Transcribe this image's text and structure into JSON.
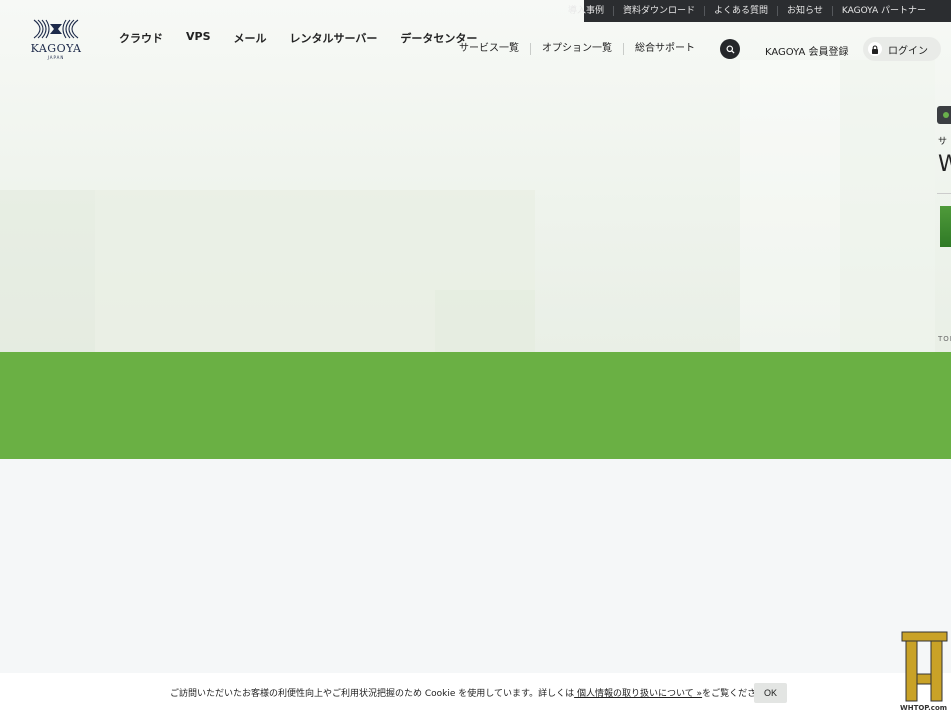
{
  "util_nav": {
    "items": [
      "導入事例",
      "資料ダウンロード",
      "よくある質問",
      "お知らせ",
      "KAGOYA パートナー"
    ]
  },
  "logo": {
    "word": "KAGOYA",
    "sub": "JAPAN"
  },
  "main_nav": {
    "items": [
      "クラウド",
      "VPS",
      "メール",
      "レンタルサーバー",
      "データセンター"
    ]
  },
  "sub_nav": {
    "items": [
      "サービス一覧",
      "オプション一覧",
      "総合サポート"
    ]
  },
  "header": {
    "member_label": "KAGOYA 会員登録",
    "login_label": "ログイン"
  },
  "side_panel": {
    "label": "サ",
    "title": "W",
    "crumb": "TOP"
  },
  "cookie": {
    "text_before": "ご訪問いただいたお客様の利便性向上やご利用状況把握のため Cookie を使用しています。詳しくは",
    "link": " 個人情報の取り扱いについて »",
    "text_after": "をご覧ください。",
    "ok_label": "OK"
  },
  "watermark": {
    "text": "WHTOP.com"
  },
  "colors": {
    "accent_green": "#6ab044",
    "dark_bar": "#2b2d30",
    "logo_navy": "#1d2a4a"
  }
}
